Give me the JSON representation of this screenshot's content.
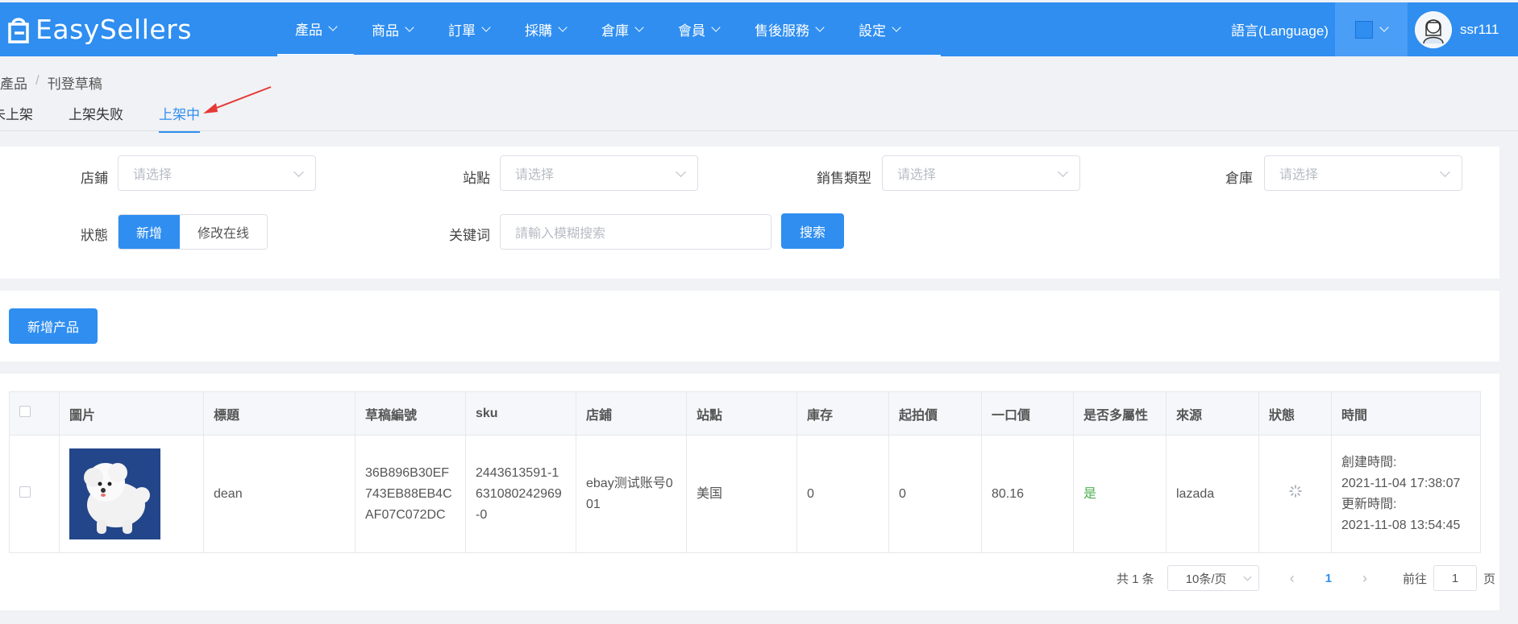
{
  "header": {
    "logo_text": "EasySellers",
    "nav": [
      {
        "label": "產品"
      },
      {
        "label": "商品"
      },
      {
        "label": "訂單"
      },
      {
        "label": "採購"
      },
      {
        "label": "倉庫"
      },
      {
        "label": "會員"
      },
      {
        "label": "售後服務"
      },
      {
        "label": "設定"
      }
    ],
    "language": "語言(Language)",
    "theme_color": "#2f8ef0",
    "username": "ssr111"
  },
  "breadcrumb": [
    "產品",
    "刊登草稿"
  ],
  "tabs": [
    {
      "label": "未上架"
    },
    {
      "label": "上架失败"
    },
    {
      "label": "上架中",
      "active": true
    }
  ],
  "filters": {
    "shop_label": "店鋪",
    "shop_placeholder": "请选择",
    "site_label": "站點",
    "site_placeholder": "请选择",
    "sale_type_label": "銷售類型",
    "sale_type_placeholder": "请选择",
    "warehouse_label": "倉庫",
    "warehouse_placeholder": "请选择",
    "status_label": "狀態",
    "status_options": [
      "新增",
      "修改在线"
    ],
    "keyword_label": "关键词",
    "keyword_placeholder": "請輸入模糊搜索",
    "search_button": "搜索"
  },
  "actions": {
    "add_product": "新增产品"
  },
  "table": {
    "columns": [
      "圖片",
      "標題",
      "草稿編號",
      "sku",
      "店鋪",
      "站點",
      "庫存",
      "起拍價",
      "一口價",
      "是否多屬性",
      "來源",
      "狀態",
      "時間"
    ],
    "rows": [
      {
        "image_icon": "dog-photo",
        "title": "dean",
        "draft_no": "36B896B30EF743EB88EB4CAF07C072DC",
        "sku": "2443613591-1631080242969-0",
        "shop": "ebay测试账号001",
        "site": "美国",
        "stock": "0",
        "start_price": "0",
        "buy_now_price": "80.16",
        "multi_attr": "是",
        "source": "lazada",
        "status_icon": "loading-icon",
        "created_label": "創建時間:",
        "created_at": "2021-11-04 17:38:07",
        "updated_label": "更新時間:",
        "updated_at": "2021-11-08 13:54:45"
      }
    ]
  },
  "pager": {
    "total": "共 1 条",
    "page_size": "10条/页",
    "current_page": "1",
    "goto_label": "前往",
    "goto_value": "1",
    "page_unit": "页"
  }
}
